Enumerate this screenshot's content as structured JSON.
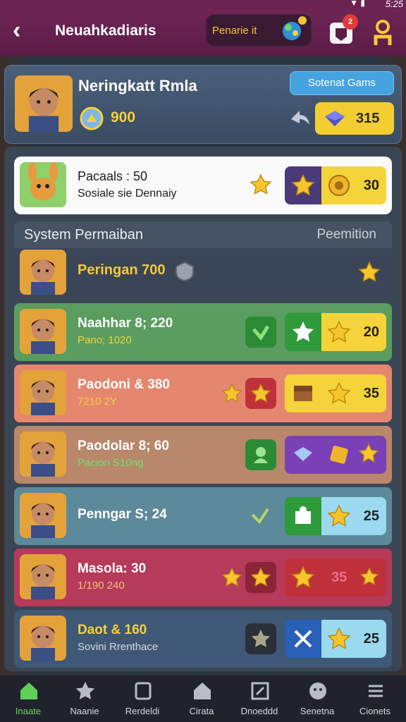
{
  "status_bar": {
    "time": "5:25"
  },
  "header": {
    "title": "Neuahkadiaris",
    "pill_label": "Penarie it",
    "notif_badge": "2"
  },
  "profile": {
    "name": "Neringkatt Rmla",
    "coins": "900",
    "gems": "315",
    "button_label": "Sotenat Gams"
  },
  "featured": {
    "title": "Pacaals : 50",
    "subtitle": "Sosiale sie Dennaiy",
    "reward_value": "30"
  },
  "section": {
    "title": "System Permaiban",
    "right_label": "Peemition",
    "row_label": "Peringan 700"
  },
  "rows": [
    {
      "title": "Naahhar 8; 220",
      "subtitle": "Pano; 1020",
      "reward": "20"
    },
    {
      "title": "Paodoni & 380",
      "subtitle": "7210 2Y",
      "reward": "35"
    },
    {
      "title": "Paodolar 8; 60",
      "subtitle": "Pacion S10ng",
      "reward": ""
    },
    {
      "title": "Penngar S; 24",
      "subtitle": "",
      "reward": "25"
    },
    {
      "title": "Masola: 30",
      "subtitle": "1/190 240",
      "reward": "35"
    },
    {
      "title": "Daot & 160",
      "subtitle": "Sovini Rrenthace",
      "reward": "25"
    }
  ],
  "nav": [
    {
      "label": "Inaate",
      "icon": "home-icon"
    },
    {
      "label": "Naanie",
      "icon": "star-burst-icon"
    },
    {
      "label": "Rerdeldi",
      "icon": "inbox-icon"
    },
    {
      "label": "Cirata",
      "icon": "house-icon"
    },
    {
      "label": "Dnoeddd",
      "icon": "edit-icon"
    },
    {
      "label": "Senetna",
      "icon": "avatar-icon"
    },
    {
      "label": "Cionets",
      "icon": "menu-icon"
    }
  ],
  "colors": {
    "header_bg": "#6f2556",
    "gold": "#f5d23a",
    "green_row": "#5a9d5e",
    "salmon_row": "#e5866f",
    "tan_row": "#b9876a",
    "teal_row": "#5c8a9a",
    "crimson_row": "#b63a59",
    "navy_row": "#3e5876",
    "active_nav": "#6fd06b"
  }
}
